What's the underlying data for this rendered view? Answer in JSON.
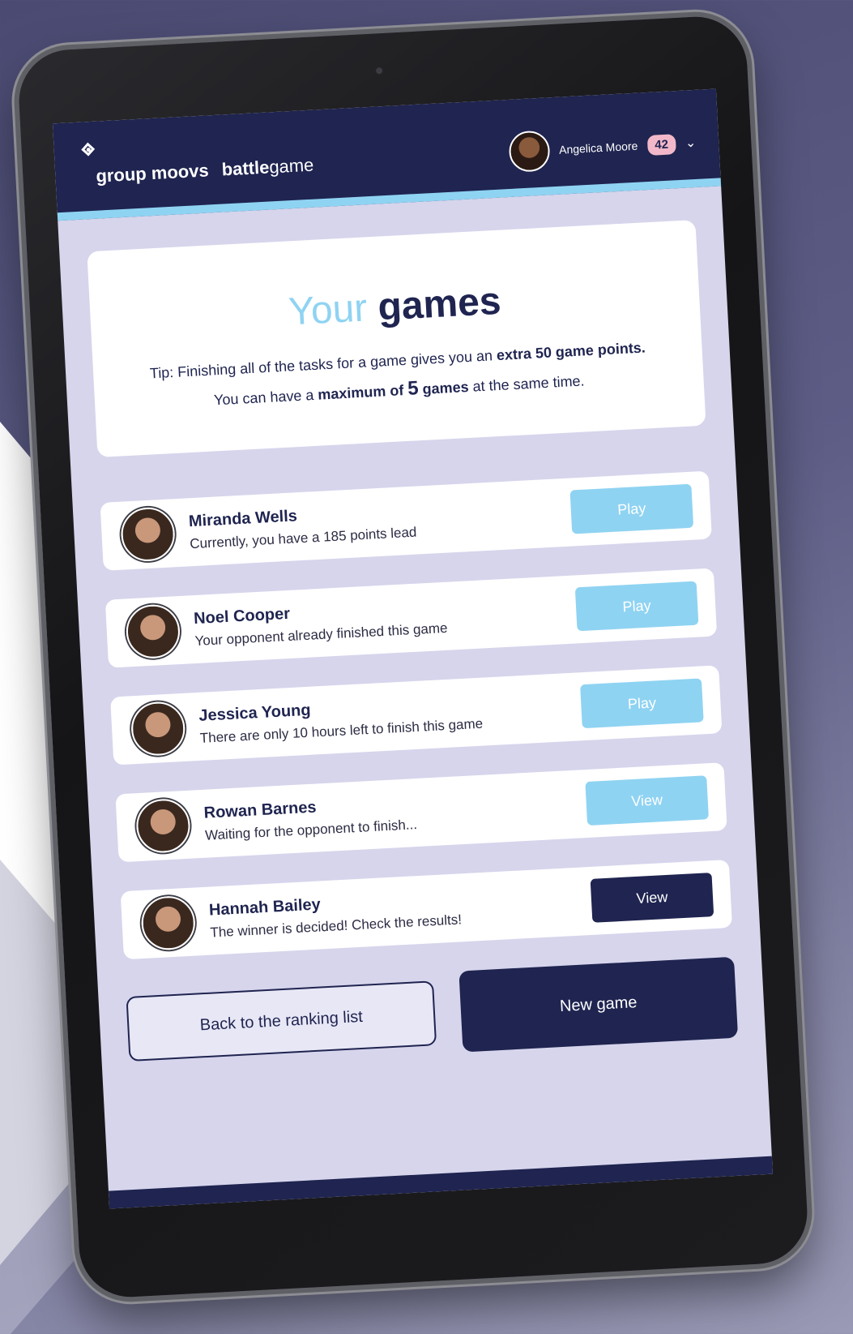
{
  "app": {
    "logo_icon": "diamond-dot-icon",
    "brand": "group moovs",
    "product_bold": "battle",
    "product_light": "game"
  },
  "user": {
    "name": "Angelica Moore",
    "points": "42",
    "menu_icon": "chevron-down-icon"
  },
  "intro": {
    "title_accent": "Your",
    "title_main": "games",
    "tip_prefix": "Tip: Finishing all of the tasks for a game gives you an",
    "tip_bold": "extra 50 game points.",
    "max_prefix": "You can have a",
    "max_bold": "maximum of",
    "max_number": "5",
    "max_games": "games",
    "max_suffix": "at the same time."
  },
  "games": [
    {
      "name": "Miranda Wells",
      "status": "Currently, you have a 185 points lead",
      "button": "Play",
      "style": "light"
    },
    {
      "name": "Noel Cooper",
      "status": "Your opponent already finished this game",
      "button": "Play",
      "style": "light"
    },
    {
      "name": "Jessica Young",
      "status": "There are only 10 hours left to finish this game",
      "button": "Play",
      "style": "light"
    },
    {
      "name": "Rowan Barnes",
      "status": "Waiting for the opponent to finish...",
      "button": "View",
      "style": "light"
    },
    {
      "name": "Hannah Bailey",
      "status": "The winner is decided! Check the results!",
      "button": "View",
      "style": "dark"
    }
  ],
  "actions": {
    "back": "Back to the ranking list",
    "new_game": "New game"
  },
  "colors": {
    "navy": "#1f2450",
    "accent_blue": "#8fd3f2",
    "badge_pink": "#f2b8c9",
    "screen_bg": "#d6d5ec"
  }
}
